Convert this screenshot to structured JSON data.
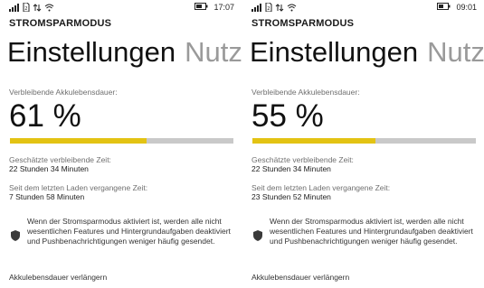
{
  "colors": {
    "accent": "#e3c313",
    "track": "#c9c9c9",
    "pivot_inactive": "#9a9a9a"
  },
  "panels": [
    {
      "clock": "17:07",
      "app_title": "STROMSPARMODUS",
      "pivot_active": "Einstellungen",
      "pivot_next": "Nutz",
      "remaining_label": "Verbleibende Akkulebensdauer:",
      "percent": "61 %",
      "battery_level": 0.61,
      "estimated_label": "Geschätzte verbleibende Zeit:",
      "estimated_value": "22 Stunden 34 Minuten",
      "since_charge_label": "Seit dem letzten Laden vergangene Zeit:",
      "since_charge_value": "7 Stunden 58 Minuten",
      "info_text": "Wenn der Stromsparmodus aktiviert ist, werden alle nicht wesentlichen Features und Hintergrundaufgaben deaktiviert und Pushbenachrichtigungen weniger häufig gesendet.",
      "extend_link": "Akkulebensdauer verlängern",
      "icons": [
        "signal-icon",
        "sim-icon",
        "data-icon",
        "wifi-icon",
        "battery-icon",
        "shield-icon"
      ]
    },
    {
      "clock": "09:01",
      "app_title": "STROMSPARMODUS",
      "pivot_active": "Einstellungen",
      "pivot_next": "Nutz",
      "remaining_label": "Verbleibende Akkulebensdauer:",
      "percent": "55 %",
      "battery_level": 0.55,
      "estimated_label": "Geschätzte verbleibende Zeit:",
      "estimated_value": "22 Stunden 34 Minuten",
      "since_charge_label": "Seit dem letzten Laden vergangene Zeit:",
      "since_charge_value": "23 Stunden 52 Minuten",
      "info_text": "Wenn der Stromsparmodus aktiviert ist, werden alle nicht wesentlichen Features und Hintergrundaufgaben deaktiviert und Pushbenachrichtigungen weniger häufig gesendet.",
      "extend_link": "Akkulebensdauer verlängern",
      "icons": [
        "signal-icon",
        "sim-icon",
        "data-icon",
        "wifi-icon",
        "battery-icon",
        "shield-icon"
      ]
    }
  ]
}
